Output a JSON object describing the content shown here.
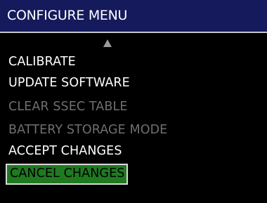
{
  "title": "CONFIGURE MENU",
  "scroll_up_icon": "triangle-up-icon",
  "colors": {
    "title_bar": "#151a5c",
    "selected_bg": "#1f7a1f",
    "enabled_text": "#ffffff",
    "disabled_text": "#6f6f6f"
  },
  "menu": {
    "items": [
      {
        "label": "CALIBRATE",
        "state": "enabled"
      },
      {
        "label": "UPDATE SOFTWARE",
        "state": "enabled"
      },
      {
        "label": "CLEAR SSEC TABLE",
        "state": "disabled"
      },
      {
        "label": "BATTERY STORAGE MODE",
        "state": "disabled"
      },
      {
        "label": "ACCEPT CHANGES",
        "state": "enabled"
      },
      {
        "label": "CANCEL CHANGES",
        "state": "selected"
      }
    ]
  }
}
